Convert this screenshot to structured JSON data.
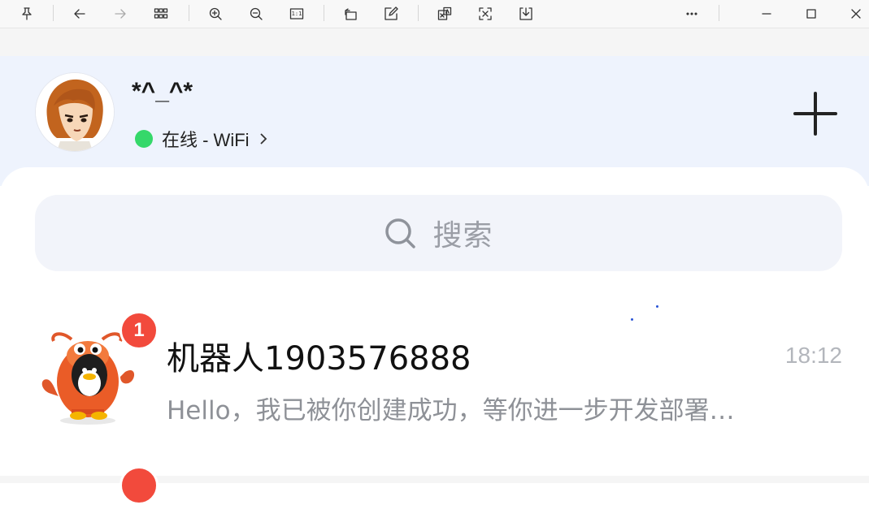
{
  "toolbar": {
    "buttons": [
      {
        "name": "pin-icon"
      },
      {
        "name": "back-arrow-icon"
      },
      {
        "name": "forward-arrow-icon",
        "disabled": true
      },
      {
        "name": "grid-view-icon"
      },
      {
        "name": "zoom-in-icon"
      },
      {
        "name": "zoom-out-icon"
      },
      {
        "name": "actual-size-icon",
        "label": "1:1"
      },
      {
        "name": "rotate-icon"
      },
      {
        "name": "edit-icon"
      },
      {
        "name": "translate-icon"
      },
      {
        "name": "extract-text-icon"
      },
      {
        "name": "save-icon"
      },
      {
        "name": "more-icon"
      },
      {
        "name": "minimize-icon"
      },
      {
        "name": "maximize-icon"
      },
      {
        "name": "close-icon"
      }
    ],
    "actual_size_label": "1:1"
  },
  "profile": {
    "nickname": "*^_^*",
    "status": "在线 - WiFi",
    "status_color": "#35d86a"
  },
  "search": {
    "placeholder": "搜索"
  },
  "chats": [
    {
      "title": "机器人1903576888",
      "time": "18:12",
      "preview": "Hello，我已被你创建成功，等你进一步开发部署…",
      "unread": "1",
      "avatar": "robot-lobster-avatar"
    }
  ],
  "colors": {
    "header_bg": "#eef3fd",
    "badge": "#f24a3c",
    "search_bg": "#f2f4fa"
  }
}
